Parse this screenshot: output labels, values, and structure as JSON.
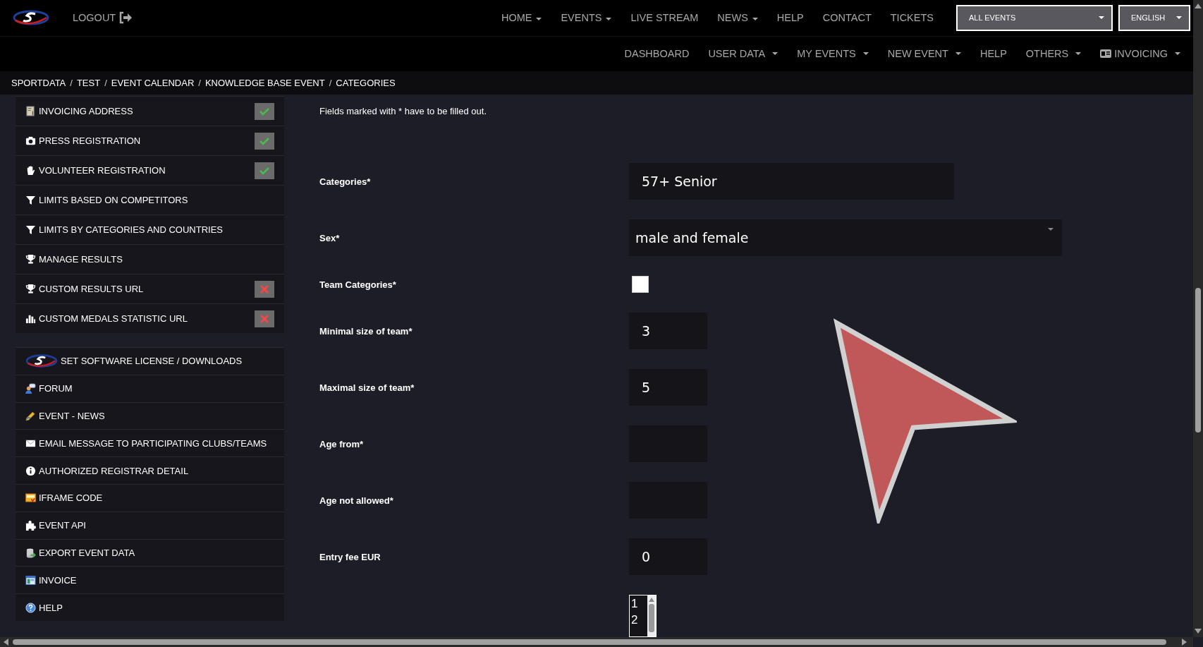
{
  "top_nav": {
    "logout": "LOGOUT",
    "items": [
      {
        "label": "HOME",
        "dropdown": true
      },
      {
        "label": "EVENTS",
        "dropdown": true
      },
      {
        "label": "LIVE STREAM",
        "dropdown": false
      },
      {
        "label": "NEWS",
        "dropdown": true
      },
      {
        "label": "HELP",
        "dropdown": false
      },
      {
        "label": "CONTACT",
        "dropdown": false
      },
      {
        "label": "TICKETS",
        "dropdown": false
      }
    ],
    "event_select": "ALL EVENTS",
    "language_select": "ENGLISH"
  },
  "sub_nav": {
    "items": [
      {
        "label": "DASHBOARD",
        "dropdown": false
      },
      {
        "label": "USER DATA",
        "dropdown": true
      },
      {
        "label": "MY EVENTS",
        "dropdown": true
      },
      {
        "label": "NEW EVENT",
        "dropdown": true
      },
      {
        "label": "HELP",
        "dropdown": false
      },
      {
        "label": "OTHERS",
        "dropdown": true
      },
      {
        "label": "INVOICING",
        "dropdown": true
      }
    ]
  },
  "breadcrumb": {
    "separator": "/",
    "items": [
      "SPORTDATA",
      "TEST",
      "EVENT CALENDAR",
      "KNOWLEDGE BASE EVENT",
      "CATEGORIES"
    ]
  },
  "sidebar": {
    "groups": [
      {
        "items": [
          {
            "label": "INVOICING ADDRESS",
            "complete": true
          },
          {
            "label": "PRESS REGISTRATION",
            "complete": true
          },
          {
            "label": "VOLUNTEER REGISTRATION",
            "complete": true
          },
          {
            "label": "LIMITS BASED ON COMPETITORS"
          },
          {
            "label": "LIMITS BY CATEGORIES AND COUNTRIES"
          },
          {
            "label": "MANAGE RESULTS"
          },
          {
            "label": "CUSTOM RESULTS URL",
            "complete": false
          },
          {
            "label": "CUSTOM MEDALS STATISTIC URL",
            "complete": false
          }
        ]
      },
      {
        "items": [
          {
            "label": "SET SOFTWARE LICENSE / DOWNLOADS"
          },
          {
            "label": "FORUM"
          },
          {
            "label": "EVENT - NEWS"
          },
          {
            "label": "EMAIL MESSAGE TO PARTICIPATING CLUBS/TEAMS"
          },
          {
            "label": "AUTHORIZED REGISTRAR DETAIL"
          },
          {
            "label": "IFRAME CODE"
          },
          {
            "label": "EVENT API"
          },
          {
            "label": "EXPORT EVENT DATA"
          },
          {
            "label": "INVOICE"
          },
          {
            "label": "HELP"
          }
        ]
      }
    ]
  },
  "form": {
    "hint": "Fields marked with * have to be filled out.",
    "rows": [
      {
        "kind": "text",
        "label": "Categories*",
        "value": "57+ Senior"
      },
      {
        "kind": "select",
        "label": "Sex*",
        "value": "male and female"
      },
      {
        "kind": "checkbox",
        "label": "Team Categories*",
        "checked": false
      },
      {
        "kind": "number",
        "label": "Minimal size of team*",
        "value": "3"
      },
      {
        "kind": "number",
        "label": "Maximal size of team*",
        "value": "5"
      },
      {
        "kind": "number",
        "label": "Age from*",
        "value": ""
      },
      {
        "kind": "number",
        "label": "Age not allowed*",
        "value": ""
      },
      {
        "kind": "number",
        "label": "Entry fee EUR",
        "value": "0"
      },
      {
        "kind": "listbox",
        "options": [
          "1",
          "2"
        ]
      }
    ]
  }
}
